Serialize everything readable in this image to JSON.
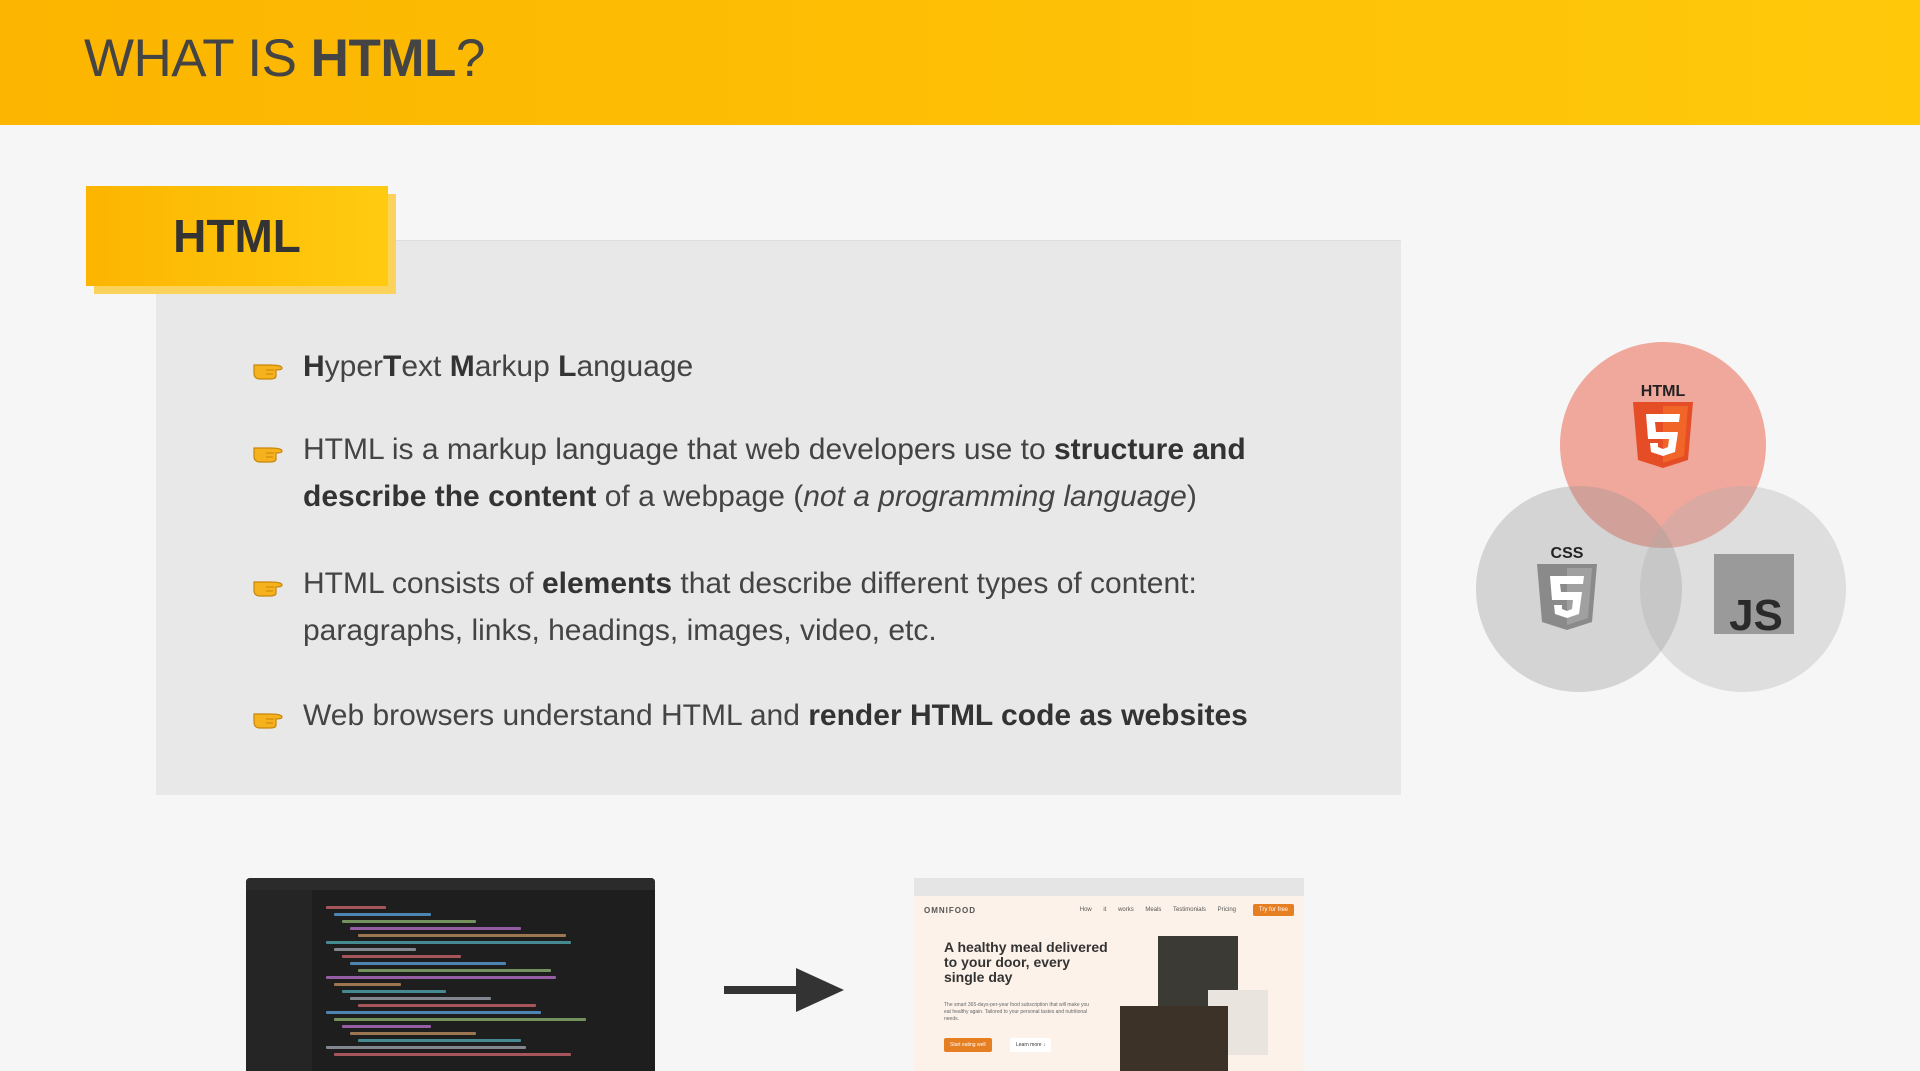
{
  "header": {
    "title_prefix": "WHAT IS ",
    "title_bold": "HTML",
    "title_suffix": "?"
  },
  "section_label": "HTML",
  "bullets": [
    {
      "icon": "pointing-hand",
      "parts": [
        {
          "b": "H"
        },
        {
          "t": "yper"
        },
        {
          "b": "T"
        },
        {
          "t": "ext "
        },
        {
          "b": "M"
        },
        {
          "t": "arkup "
        },
        {
          "b": "L"
        },
        {
          "t": "anguage"
        }
      ]
    },
    {
      "icon": "pointing-hand",
      "parts": [
        {
          "t": "HTML is a markup language that web developers use to "
        },
        {
          "b": "structure and describe the content"
        },
        {
          "t": " of a webpage ("
        },
        {
          "i": "not a programming language"
        },
        {
          "t": ")"
        }
      ]
    },
    {
      "icon": "pointing-hand",
      "parts": [
        {
          "t": "HTML consists of "
        },
        {
          "b": "elements"
        },
        {
          "t": " that describe different types of content: paragraphs, links, headings, images, video, etc."
        }
      ]
    },
    {
      "icon": "pointing-hand",
      "parts": [
        {
          "t": "Web browsers understand HTML and "
        },
        {
          "b": "render HTML code as websites"
        }
      ]
    }
  ],
  "venn": {
    "html_label": "HTML",
    "css_label": "CSS",
    "js_label": "JS",
    "html_badge_color": "#e44d26",
    "css_badge_color": "#8a8a8a",
    "js_badge_color": "#9a9a9a"
  },
  "website_preview": {
    "brand": "OMNIFOOD",
    "nav": "How it works Meals Testimonials Pricing",
    "cta": "Try for free",
    "headline": "A healthy meal delivered to your door, every single day",
    "sub": "The smart 365-days-per-year food subscription that will make you eat healthy again. Tailored to your personal tastes and nutritional needs.",
    "primary_btn": "Start eating well",
    "secondary_btn": "Learn more ↓"
  },
  "colors": {
    "accent": "#fcb500",
    "text": "#444444",
    "panel": "#e8e8e8",
    "background": "#f6f6f6"
  }
}
